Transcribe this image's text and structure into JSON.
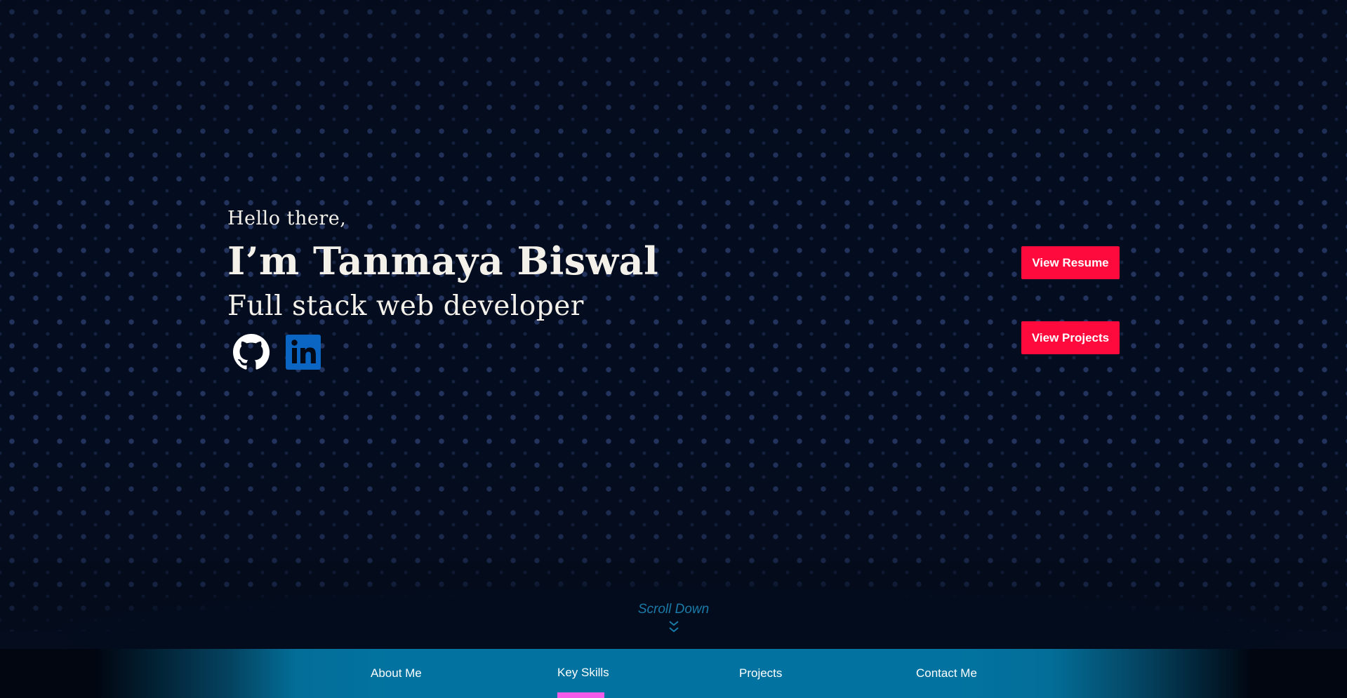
{
  "hero": {
    "greeting": "Hello there,",
    "name": "I’m Tanmaya Biswal",
    "role": "Full stack web developer",
    "socials": [
      {
        "icon": "github-icon",
        "color": "#ffffff"
      },
      {
        "icon": "linkedin-icon",
        "color": "#0a66c2"
      }
    ]
  },
  "actions": {
    "resume_label": "View Resume",
    "projects_label": "View Projects",
    "button_color": "#ff0a3c"
  },
  "scroll": {
    "label": "Scroll Down",
    "icon": "double-chevron-down-icon"
  },
  "nav": {
    "items": [
      {
        "label": "About Me"
      },
      {
        "label": "Key Skills",
        "active": true
      },
      {
        "label": "Projects"
      },
      {
        "label": "Contact Me"
      }
    ],
    "bar_color": "#0273a1",
    "indicator_color": "#f35be8"
  }
}
